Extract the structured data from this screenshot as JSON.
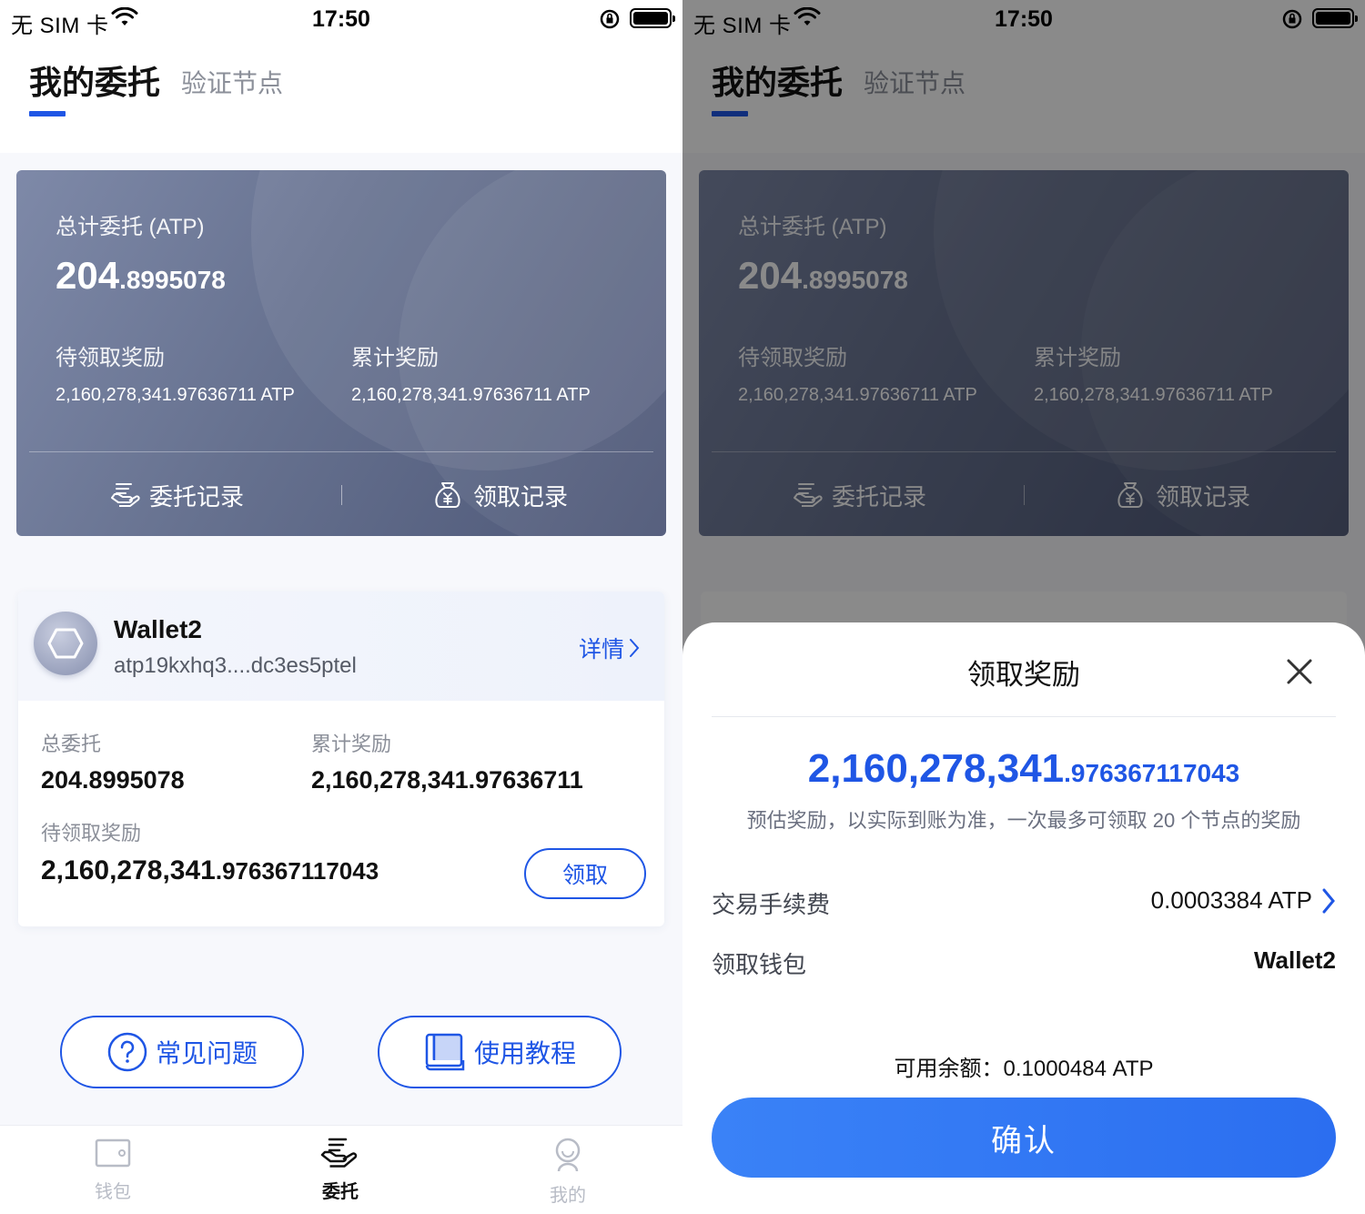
{
  "status_bar": {
    "carrier": "无 SIM 卡",
    "time": "17:50"
  },
  "header": {
    "tab_active": "我的委托",
    "tab_inactive": "验证节点"
  },
  "summary": {
    "total_label": "总计委托 (ATP)",
    "total_int": "204",
    "total_dec": ".8995078",
    "pending_label": "待领取奖励",
    "pending_value": "2,160,278,341.97636711 ATP",
    "cumulative_label": "累计奖励",
    "cumulative_value": "2,160,278,341.97636711 ATP",
    "delegation_records": "委托记录",
    "claim_records": "领取记录"
  },
  "wallet": {
    "name": "Wallet2",
    "address": "atp19kxhq3....dc3es5ptel",
    "detail_link": "详情",
    "total_delegation_label": "总委托",
    "total_delegation_value": "204.8995078",
    "cumulative_reward_label": "累计奖励",
    "cumulative_reward_value": "2,160,278,341.97636711",
    "pending_label": "待领取奖励",
    "pending_int": "2,160,278,341",
    "pending_dec": ".976367117043",
    "claim_button": "领取"
  },
  "help": {
    "faq": "常见问题",
    "tutorial": "使用教程"
  },
  "tabbar": {
    "wallet": "钱包",
    "delegation": "委托",
    "mine": "我的"
  },
  "sheet": {
    "title": "领取奖励",
    "amount_int": "2,160,278,341",
    "amount_dec": ".976367117043",
    "note": "预估奖励，以实际到账为准，一次最多可领取 20 个节点的奖励",
    "fee_label": "交易手续费",
    "fee_value": "0.0003384 ATP",
    "wallet_label": "领取钱包",
    "wallet_value": "Wallet2",
    "balance": "可用余额：0.1000484 ATP",
    "confirm": "确认",
    "peek_name": "Wallet2"
  },
  "colors": {
    "accent": "#1f56e5",
    "card": "#66718f",
    "confirm": "#2b6ef0"
  }
}
